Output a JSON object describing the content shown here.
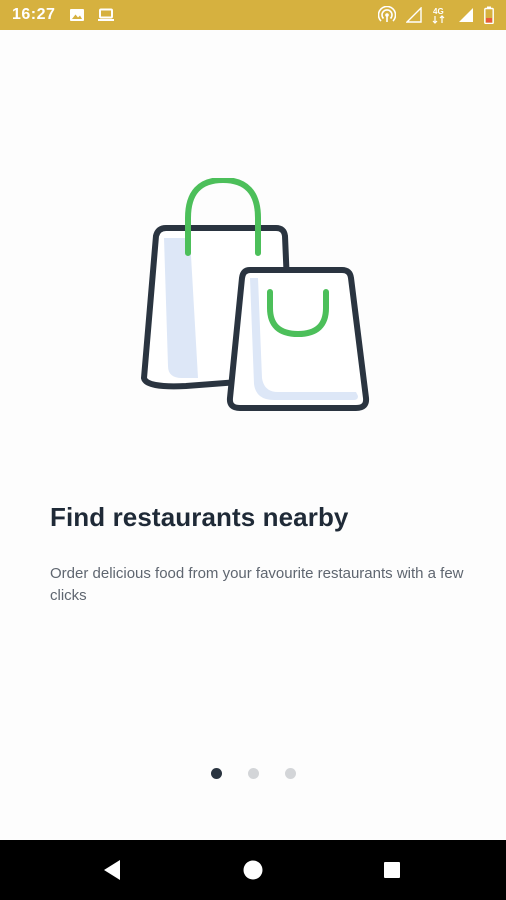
{
  "status_bar": {
    "time": "16:27",
    "icons": [
      "image-icon",
      "laptop-icon",
      "hotspot-icon",
      "signal-icon",
      "network-4g-icon",
      "signal-full-icon",
      "battery-icon"
    ]
  },
  "onboarding": {
    "illustration": "shopping-bags-icon",
    "title": "Find restaurants nearby",
    "description": "Order delicious food from your favourite restaurants with a few clicks",
    "pager": {
      "count": 3,
      "active_index": 0
    }
  },
  "nav_bar": {
    "buttons": [
      "back-icon",
      "home-icon",
      "recents-icon"
    ]
  },
  "colors": {
    "status_bar": "#d6b13f",
    "bag_outline": "#2a3440",
    "bag_handle": "#4cbf5a",
    "bag_fill": "#dde7f7",
    "dot_active": "#2a3440",
    "dot_inactive": "#d3d5d8"
  }
}
